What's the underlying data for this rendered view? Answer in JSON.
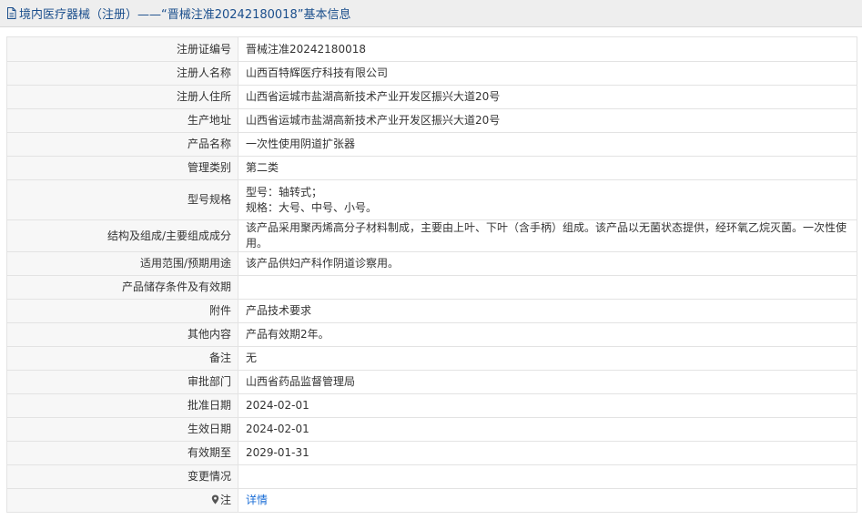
{
  "header": {
    "title": "境内医疗器械（注册）——“晋械注准20242180018”基本信息",
    "icon": "document-icon"
  },
  "rows": [
    {
      "key": "reg_no",
      "label": "注册证编号",
      "value": "晋械注准20242180018"
    },
    {
      "key": "registrant",
      "label": "注册人名称",
      "value": "山西百特辉医疗科技有限公司"
    },
    {
      "key": "registrant_address",
      "label": "注册人住所",
      "value": "山西省运城市盐湖高新技术产业开发区振兴大道20号"
    },
    {
      "key": "production_address",
      "label": "生产地址",
      "value": "山西省运城市盐湖高新技术产业开发区振兴大道20号"
    },
    {
      "key": "product_name",
      "label": "产品名称",
      "value": "一次性使用阴道扩张器"
    },
    {
      "key": "management_class",
      "label": "管理类别",
      "value": "第二类"
    },
    {
      "key": "model_spec",
      "label": "型号规格",
      "value_lines": [
        "型号：轴转式；",
        "规格：大号、中号、小号。"
      ]
    },
    {
      "key": "structure",
      "label": "结构及组成/主要组成成分",
      "value": "该产品采用聚丙烯高分子材料制成，主要由上叶、下叶（含手柄）组成。该产品以无菌状态提供，经环氧乙烷灭菌。一次性使用。"
    },
    {
      "key": "scope",
      "label": "适用范围/预期用途",
      "value": "该产品供妇产科作阴道诊察用。"
    },
    {
      "key": "storage",
      "label": "产品储存条件及有效期",
      "value": ""
    },
    {
      "key": "attachment",
      "label": "附件",
      "value": "产品技术要求"
    },
    {
      "key": "other",
      "label": "其他内容",
      "value": "产品有效期2年。"
    },
    {
      "key": "remarks",
      "label": "备注",
      "value": "无"
    },
    {
      "key": "approval_dept",
      "label": "审批部门",
      "value": "山西省药品监督管理局"
    },
    {
      "key": "approval_date",
      "label": "批准日期",
      "value": "2024-02-01"
    },
    {
      "key": "effective_date",
      "label": "生效日期",
      "value": "2024-02-01"
    },
    {
      "key": "expiry_date",
      "label": "有效期至",
      "value": "2029-01-31"
    },
    {
      "key": "changes",
      "label": "变更情况",
      "value": ""
    },
    {
      "key": "note",
      "label": "注",
      "value": "详情",
      "icon": "pin-icon"
    }
  ],
  "colors": {
    "title_text": "#1a4e8c",
    "title_bg": "#eeeeee",
    "label_bg": "#f7f7f7",
    "border": "#e3e3e3",
    "link": "#1a6dd6"
  }
}
